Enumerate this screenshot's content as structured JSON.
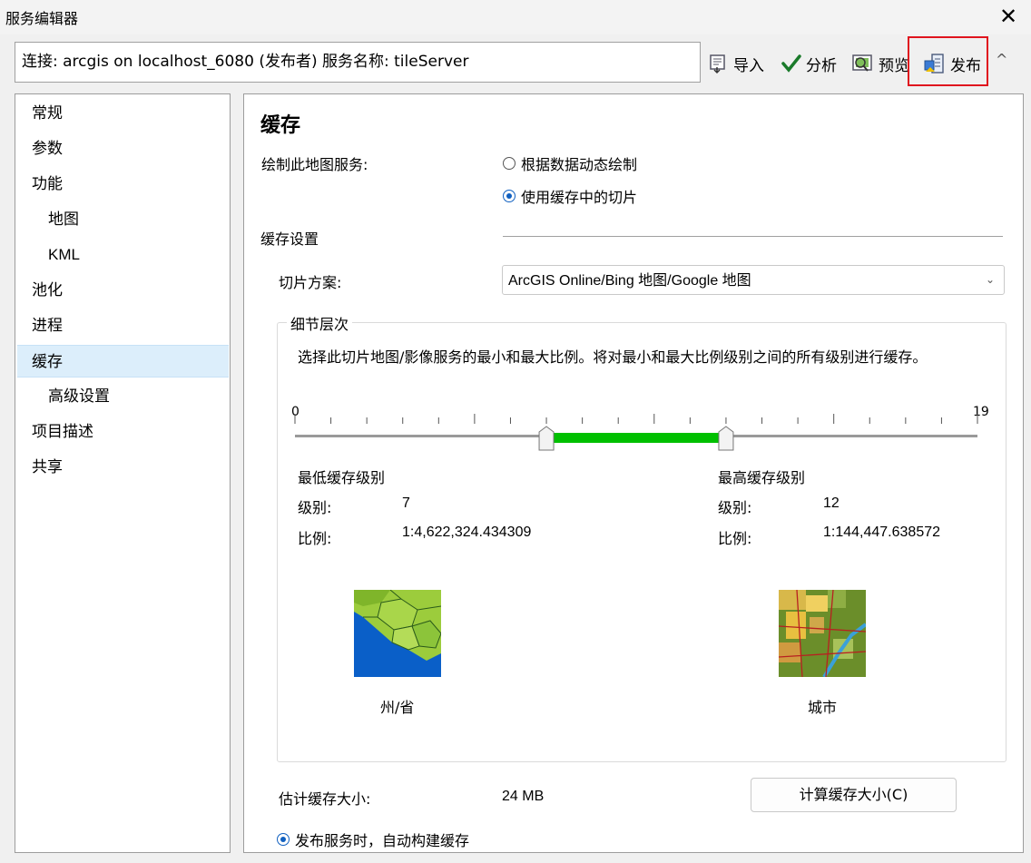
{
  "window": {
    "title": "服务编辑器",
    "close_glyph": "✕"
  },
  "connection": {
    "text": "连接: arcgis on localhost_6080 (发布者)  服务名称: tileServer"
  },
  "toolbar": {
    "import_label": "导入",
    "analyze_label": "分析",
    "preview_label": "预览",
    "publish_label": "发布",
    "collapse_glyph": "^"
  },
  "nav": {
    "items": [
      {
        "label": "常规"
      },
      {
        "label": "参数"
      },
      {
        "label": "功能"
      },
      {
        "label": "地图"
      },
      {
        "label": "KML"
      },
      {
        "label": "池化"
      },
      {
        "label": "进程"
      },
      {
        "label": "缓存"
      },
      {
        "label": "高级设置"
      },
      {
        "label": "项目描述"
      },
      {
        "label": "共享"
      }
    ],
    "selected": "缓存"
  },
  "cache": {
    "heading": "缓存",
    "draw_label": "绘制此地图服务:",
    "draw_options": [
      {
        "label": "根据数据动态绘制",
        "checked": false
      },
      {
        "label": "使用缓存中的切片",
        "checked": true
      }
    ],
    "settings_label": "缓存设置",
    "scheme_label": "切片方案:",
    "scheme_value": "ArcGIS Online/Bing 地图/Google 地图",
    "lod_title": "细节层次",
    "lod_desc": "选择此切片地图/影像服务的最小和最大比例。将对最小和最大比例级别之间的所有级别进行缓存。",
    "slider": {
      "min_label": "0",
      "max_label": "19",
      "min": 0,
      "max": 19,
      "low": 7,
      "high": 12
    },
    "min_level": {
      "title": "最低缓存级别",
      "level_label": "级别:",
      "level_value": "7",
      "scale_label": "比例:",
      "scale_value": "1:4,622,324.434309",
      "thumb_caption": "州/省"
    },
    "max_level": {
      "title": "最高缓存级别",
      "level_label": "级别:",
      "level_value": "12",
      "scale_label": "比例:",
      "scale_value": "1:144,447.638572",
      "thumb_caption": "城市"
    },
    "estimate_label": "估计缓存大小:",
    "estimate_value": "24 MB",
    "calc_button": "计算缓存大小(C)",
    "auto_build_label": "发布服务时，自动构建缓存",
    "auto_build_checked": true,
    "colors": {
      "slider_range": "#00c000",
      "highlight": "#e0141e",
      "selection": "#dceefb"
    }
  }
}
